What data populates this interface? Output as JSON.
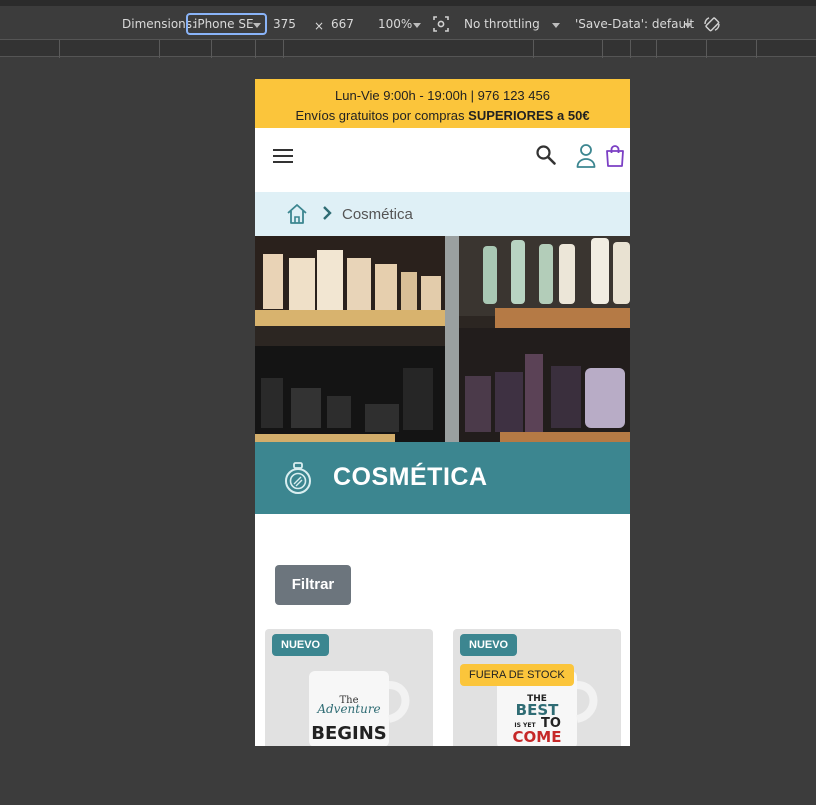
{
  "devtools": {
    "dimensions_label": "Dimensions:",
    "device": "iPhone SE",
    "width": "375",
    "times": "×",
    "height": "667",
    "zoom": "100%",
    "throttling": "No throttling",
    "save_data": "'Save-Data': default"
  },
  "site": {
    "topbar": {
      "hours": "Lun-Vie 9:00h - 19:00h | 976 123 456",
      "shipping_prefix": "Envíos gratuitos por compras ",
      "shipping_bold": "SUPERIORES a 50€"
    },
    "breadcrumb": {
      "current": "Cosmética"
    },
    "category": {
      "title": "COSMÉTICA"
    },
    "filter_label": "Filtrar",
    "products": [
      {
        "badge": "NUEVO",
        "mug_text": [
          "The",
          "Adventure",
          "BEGINS"
        ]
      },
      {
        "badge": "NUEVO",
        "stock_badge": "FUERA DE STOCK",
        "mug_text": [
          "THE",
          "BEST",
          "IS YET",
          "TO",
          "COME"
        ]
      }
    ]
  },
  "colors": {
    "accent_yellow": "#fbc53b",
    "teal": "#3c8690",
    "breadcrumb_bg": "#dff0f6",
    "filter_gray": "#6c757d"
  }
}
